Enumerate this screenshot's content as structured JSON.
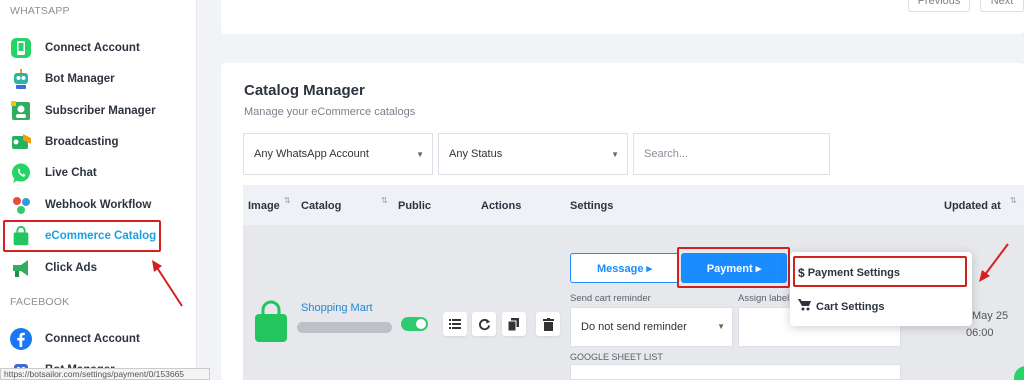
{
  "sidebar": {
    "whatsapp_title": "WHATSAPP",
    "facebook_title": "FACEBOOK",
    "items": [
      {
        "label": "Connect Account",
        "icon": "whatsapp-icon"
      },
      {
        "label": "Bot Manager",
        "icon": "robot-icon"
      },
      {
        "label": "Subscriber Manager",
        "icon": "subscriber-icon"
      },
      {
        "label": "Broadcasting",
        "icon": "broadcast-icon"
      },
      {
        "label": "Live Chat",
        "icon": "chat-bubble-icon"
      },
      {
        "label": "Webhook Workflow",
        "icon": "webhook-icon"
      },
      {
        "label": "eCommerce Catalog",
        "icon": "shopping-bag-icon"
      },
      {
        "label": "Click Ads",
        "icon": "megaphone-icon"
      }
    ],
    "fb_items": [
      {
        "label": "Connect Account",
        "icon": "facebook-icon"
      },
      {
        "label": "Bot Manager",
        "icon": "robot-icon"
      }
    ]
  },
  "pager": {
    "previous": "Previous",
    "next": "Next"
  },
  "catalog": {
    "title": "Catalog Manager",
    "subtitle": "Manage your eCommerce catalogs",
    "filters": {
      "account": "Any WhatsApp Account",
      "status": "Any Status",
      "search_placeholder": "Search..."
    },
    "columns": [
      "Image",
      "Catalog",
      "Public",
      "Actions",
      "Settings",
      "Updated at"
    ],
    "row": {
      "name": "Shopping Mart",
      "message_btn": "Message ▸",
      "payment_btn": "Payment ▸",
      "send_cart_label": "Send cart reminder",
      "send_cart_value": "Do not send reminder",
      "assign_label": "Assign label",
      "google_sheet": "GOOGLE SHEET LIST",
      "updated_date": "May 25",
      "updated_time": "06:00"
    },
    "dropdown": {
      "payment_settings": "Payment Settings",
      "cart_settings": "Cart Settings"
    }
  },
  "status_url": "https://botsailor.com/settings/payment/0/153665",
  "colors": {
    "accent": "#1e9fe0",
    "primary_btn": "#1a8cff",
    "highlight": "#d42020",
    "toggle": "#2ecc71",
    "bag": "#22c55e"
  }
}
